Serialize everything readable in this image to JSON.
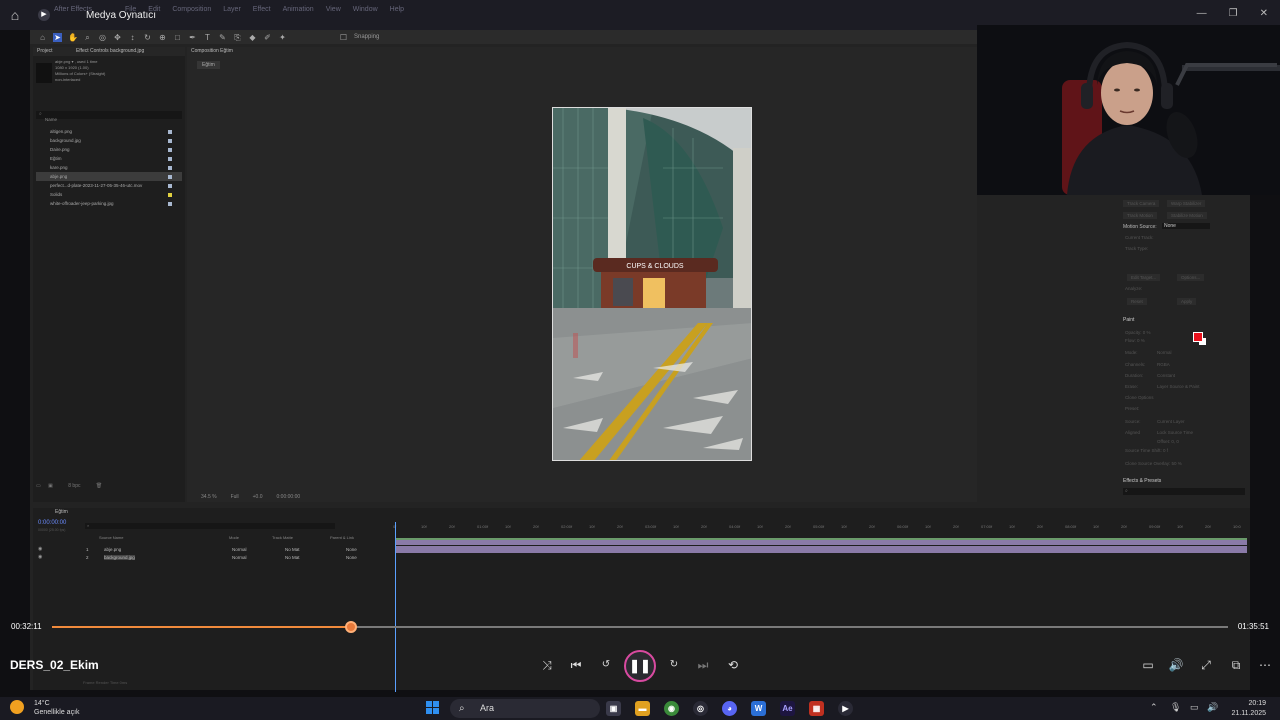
{
  "player": {
    "app_title": "Medya Oynatıcı",
    "video_title": "DERS_02_Ekim",
    "time_current": "00:32:11",
    "time_total": "01:35:51",
    "progress": 0.254,
    "accent": "#f08a3c"
  },
  "ae": {
    "menu": [
      "After Effects",
      "File",
      "Edit",
      "Composition",
      "Layer",
      "Effect",
      "Animation",
      "View",
      "Window",
      "Help"
    ],
    "snapping": "Snapping",
    "project_tab": "Project",
    "effect_controls_tab": "Effect Controls background.jpg",
    "comp_tab": "Composition Eğtim",
    "comp_crumb": "Eğtim",
    "project_info": [
      "abje.png ▾ , used 1 time",
      "1080 x 1920 (1.00)",
      "Millions of Colors+ (Straight)",
      "non-interlaced"
    ],
    "project_col_name": "Name",
    "project_items": [
      {
        "name": "altigen.png",
        "color": "b"
      },
      {
        "name": "background.jpg",
        "color": "b"
      },
      {
        "name": "Daire.png",
        "color": "b"
      },
      {
        "name": "Eğtim",
        "color": "b"
      },
      {
        "name": "kare.png",
        "color": "b"
      },
      {
        "name": "abje.png",
        "color": "b",
        "selected": true
      },
      {
        "name": "perfect...d-plate-2023-11-27-05-35-46-utc.mov",
        "color": "b"
      },
      {
        "name": "Solids",
        "color": "y"
      },
      {
        "name": "white-offroader-jeep-parking.jpg",
        "color": "b"
      }
    ],
    "bpc": "8 bpc",
    "comp_footer": {
      "zoom": "34.5 %",
      "res": "Full",
      "time": "0:00:00:00",
      "exposure": "+0.0"
    },
    "right_panel": {
      "track_camera": "Track Camera",
      "warp_stabilizer": "Warp Stabilizer",
      "track_motion": "Track Motion",
      "stabilize_motion": "Stabilize Motion",
      "motion_source_label": "Motion Source:",
      "motion_source_value": "None",
      "current_track": "Current Track:",
      "track_type": "Track Type:",
      "analyze": "Analyze:",
      "reset": "Reset",
      "apply": "Apply",
      "edit_target": "Edit Target...",
      "options": "Options...",
      "paint": "Paint",
      "opacity": "Opacity: 0 %",
      "flow": "Flow: 0 %",
      "mode": "Mode:",
      "mode_value": "Normal",
      "channels": "Channels:",
      "channels_value": "RGBA",
      "duration": "Duration:",
      "duration_value": "Constant",
      "erase": "Erase:",
      "erase_value": "Layer Source & Paint",
      "clone_options": "Clone Options",
      "preset": "Preset:",
      "source": "Source:",
      "source_value": "Current Layer",
      "aligned": "Aligned",
      "lock_source": "Lock Source Time",
      "offset": "Offset: 0, 0",
      "source_time_shift": "Source Time Shift: 0 f",
      "clone_overlay": "Clone Source Overlay: 50 %",
      "effects_presets": "Effects & Presets",
      "fg_color": "#e8101c"
    },
    "timeline": {
      "tab": "Eğtim",
      "timecode": "0:00:00:00",
      "fps": "00000 (25.00 fps)",
      "cols": {
        "source": "Source Name",
        "mode": "Mode",
        "matte": "Track Matte",
        "parent": "Parent & Link"
      },
      "layers": [
        {
          "num": "1",
          "name": "abje.png",
          "mode": "Normal",
          "matte": "No Mat",
          "parent": "None"
        },
        {
          "num": "2",
          "name": "background.jpg",
          "mode": "Normal",
          "matte": "No Mat",
          "parent": "None"
        }
      ],
      "ruler": [
        "0f",
        "10f",
        "20f",
        "01:00f",
        "10f",
        "20f",
        "02:00f",
        "10f",
        "20f",
        "03:00f",
        "10f",
        "20f",
        "04:00f",
        "10f",
        "20f",
        "05:00f",
        "10f",
        "20f",
        "06:00f",
        "10f",
        "20f",
        "07:00f",
        "10f",
        "20f",
        "08:00f",
        "10f",
        "20f",
        "09:00f",
        "10f",
        "20f",
        "10:0"
      ],
      "frame_render_time": "Frame Render Time  0ms"
    },
    "sign_text": "CUPS & CLOUDS"
  },
  "taskbar": {
    "temp": "14°C",
    "weather": "Genellikle açık",
    "search": "Ara",
    "time": "20:19",
    "date": "21.11.2025"
  },
  "icons": [
    "home-icon",
    "shuffle-icon",
    "previous-icon",
    "rewind-10-icon",
    "pause-icon",
    "forward-30-icon",
    "next-icon",
    "repeat-off-icon",
    "miniplayer-icon",
    "volume-icon",
    "fullscreen-icon",
    "popout-icon",
    "more-icon"
  ]
}
